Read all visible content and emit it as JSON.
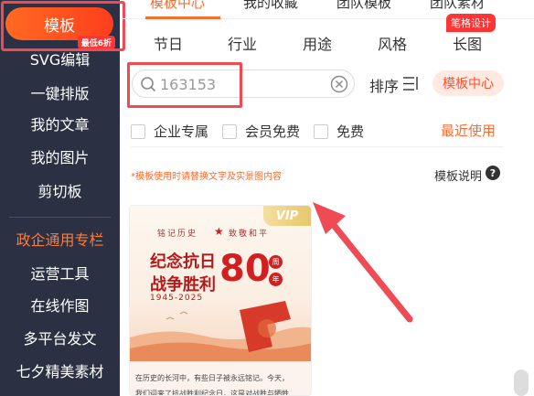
{
  "sidebar": {
    "main_button": "模板",
    "main_badge": "最低6折",
    "items": [
      "SVG编辑",
      "一键排版",
      "我的文章",
      "我的图片",
      "剪切板"
    ],
    "section_title": "政企通用专栏",
    "section_items": [
      "运营工具",
      "在线作图",
      "多平台发文",
      "七夕精美素材"
    ]
  },
  "top_tabs": [
    "模板中心",
    "我的收藏",
    "团队模板",
    "团队素材"
  ],
  "categories": [
    "节日",
    "行业",
    "用途",
    "风格",
    "长图"
  ],
  "category_badge": "笔格设计",
  "search": {
    "value": "163153",
    "placeholder": ""
  },
  "sort_label": "排序",
  "template_center_button": "模板中心",
  "filters": [
    "企业专属",
    "会员免费",
    "免费"
  ],
  "recent_label": "最近使用",
  "hint": "*模板使用时请替换文字及实景图内容",
  "help_label": "模板说明",
  "help_icon_text": "?",
  "card": {
    "vip": "VIP",
    "motto_left": "铭记历史",
    "motto_right": "致敬和平",
    "title_line1": "纪念抗日",
    "title_line2": "战争胜利",
    "years": "1945-2025",
    "big_number": "80",
    "circle1": "周",
    "circle2": "年",
    "body_line1": "在历史的长河中，有些日子被永远铭记。今天，",
    "body_line2": "我们迎来了抗战胜利纪念日，这是对战胜与牺牲"
  },
  "colors": {
    "accent": "#ff6b2c",
    "sidebar_bg": "#2b3142",
    "highlight": "#f04a55"
  }
}
